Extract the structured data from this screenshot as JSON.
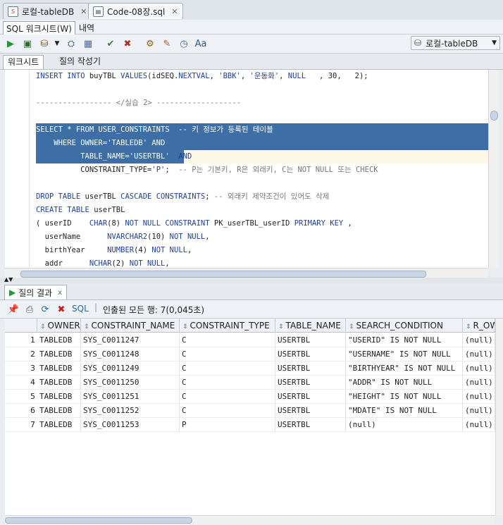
{
  "tabs": [
    {
      "label": "로컬-tableDB",
      "active": false
    },
    {
      "label": "Code-08장.sql",
      "active": true
    }
  ],
  "subtabs": [
    "SQL 워크시트(W)",
    "내역"
  ],
  "connection": "로컬-tableDB",
  "worksheet_tabs": [
    "워크시트",
    "질의 작성기"
  ],
  "editor": {
    "lines": [
      {
        "segments": [
          [
            "kw",
            "INSERT INTO "
          ],
          [
            "t",
            "buyTBL "
          ],
          [
            "kw",
            "VALUES"
          ],
          [
            "t",
            "(idSEQ."
          ],
          [
            "kw",
            "NEXTVAL"
          ],
          [
            "t",
            ", "
          ],
          [
            "str",
            "'BBK'"
          ],
          [
            "t",
            ", "
          ],
          [
            "str",
            "'운동화'"
          ],
          [
            "t",
            ", "
          ],
          [
            "kw",
            "NULL"
          ],
          [
            "t",
            "   , 30,   2);"
          ]
        ]
      },
      {
        "segments": []
      },
      {
        "segments": [
          [
            "cm",
            "----------------- </실습 2> -------------------"
          ]
        ]
      },
      {
        "segments": []
      },
      {
        "segments": [
          [
            "t",
            "SELECT * FROM USER_CONSTRAINTS  -- 키 정보가 등록된 테이블"
          ]
        ],
        "selected": true
      },
      {
        "segments": [
          [
            "t",
            "    WHERE OWNER='TABLEDB' AND"
          ]
        ],
        "selected": true
      },
      {
        "segments": [
          [
            "t",
            "          TABLE_NAME='USERTBL'"
          ]
        ],
        "selected": true,
        "tail": [
          [
            "kw",
            "  AND"
          ]
        ]
      },
      {
        "segments": [
          [
            "t",
            "          CONSTRAINT_TYPE="
          ],
          [
            "str",
            "'P'"
          ],
          [
            "t",
            "; "
          ],
          [
            "cm",
            " -- P는 기본키, R은 외래키, C는 NOT NULL 또는 CHECK"
          ]
        ]
      },
      {
        "segments": []
      },
      {
        "segments": [
          [
            "kw",
            "DROP TABLE "
          ],
          [
            "t",
            "userTBL "
          ],
          [
            "kw",
            "CASCADE CONSTRAINTS"
          ],
          [
            "t",
            "; "
          ],
          [
            "cm",
            "-- 외래키 제약조건이 있어도 삭제"
          ]
        ]
      },
      {
        "segments": [
          [
            "kw",
            "CREATE TABLE "
          ],
          [
            "t",
            "userTBL"
          ]
        ]
      },
      {
        "segments": [
          [
            "t",
            "( userID    "
          ],
          [
            "kw",
            "CHAR"
          ],
          [
            "t",
            "(8) "
          ],
          [
            "kw",
            "NOT NULL CONSTRAINT "
          ],
          [
            "t",
            "PK_userTBL_userID "
          ],
          [
            "kw",
            "PRIMARY KEY"
          ],
          [
            "t",
            " ,"
          ]
        ]
      },
      {
        "segments": [
          [
            "t",
            "  userName      "
          ],
          [
            "kw",
            "NVARCHAR2"
          ],
          [
            "t",
            "(10) "
          ],
          [
            "kw",
            "NOT NULL"
          ],
          [
            "t",
            ","
          ]
        ]
      },
      {
        "segments": [
          [
            "t",
            "  birthYear     "
          ],
          [
            "kw",
            "NUMBER"
          ],
          [
            "t",
            "(4) "
          ],
          [
            "kw",
            "NOT NULL"
          ],
          [
            "t",
            ","
          ]
        ]
      },
      {
        "segments": [
          [
            "t",
            "  addr      "
          ],
          [
            "kw",
            "NCHAR"
          ],
          [
            "t",
            "(2) "
          ],
          [
            "kw",
            "NOT NULL"
          ],
          [
            "t",
            ","
          ]
        ]
      }
    ]
  },
  "results": {
    "tab_label": "질의 결과",
    "sql_label": "SQL",
    "status": "인출된 모든 행: 7(0,045초)",
    "columns": [
      "OWNER",
      "CONSTRAINT_NAME",
      "CONSTRAINT_TYPE",
      "TABLE_NAME",
      "SEARCH_CONDITION",
      "R_OW"
    ],
    "rows": [
      [
        "1",
        "TABLEDB",
        "SYS_C0011247",
        "C",
        "USERTBL",
        "\"USERID\" IS NOT NULL",
        "(null)"
      ],
      [
        "2",
        "TABLEDB",
        "SYS_C0011248",
        "C",
        "USERTBL",
        "\"USERNAME\" IS NOT NULL",
        "(null)"
      ],
      [
        "3",
        "TABLEDB",
        "SYS_C0011249",
        "C",
        "USERTBL",
        "\"BIRTHYEAR\" IS NOT NULL",
        "(null)"
      ],
      [
        "4",
        "TABLEDB",
        "SYS_C0011250",
        "C",
        "USERTBL",
        "\"ADDR\" IS NOT NULL",
        "(null)"
      ],
      [
        "5",
        "TABLEDB",
        "SYS_C0011251",
        "C",
        "USERTBL",
        "\"HEIGHT\" IS NOT NULL",
        "(null)"
      ],
      [
        "6",
        "TABLEDB",
        "SYS_C0011252",
        "C",
        "USERTBL",
        "\"MDATE\" IS NOT NULL",
        "(null)"
      ],
      [
        "7",
        "TABLEDB",
        "SYS_C0011253",
        "P",
        "USERTBL",
        "(null)",
        "(null)"
      ]
    ]
  },
  "colors": {
    "selection": "#3d6ea5",
    "keyword": "#1f3f9e",
    "comment": "#777777"
  }
}
